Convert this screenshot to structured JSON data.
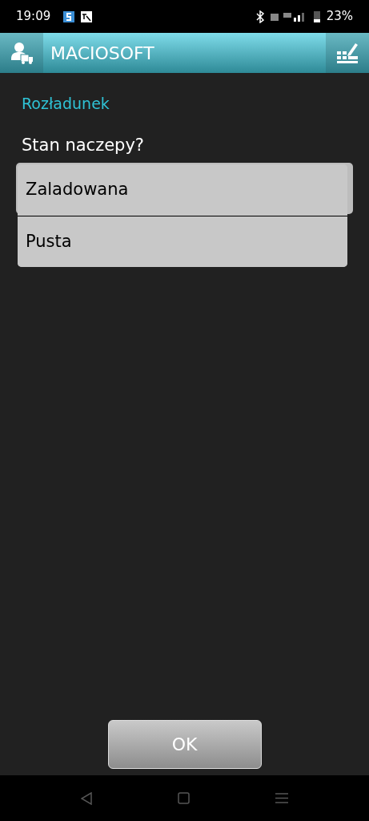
{
  "status_bar": {
    "time": "19:09",
    "battery": "23%"
  },
  "header": {
    "title": "MACIOSOFT"
  },
  "section_title": "Rozładunek",
  "question": "Stan naczepy?",
  "dropdown_options": [
    {
      "label": "Zaladowana"
    },
    {
      "label": "Pusta"
    }
  ],
  "ok_button": "OK"
}
